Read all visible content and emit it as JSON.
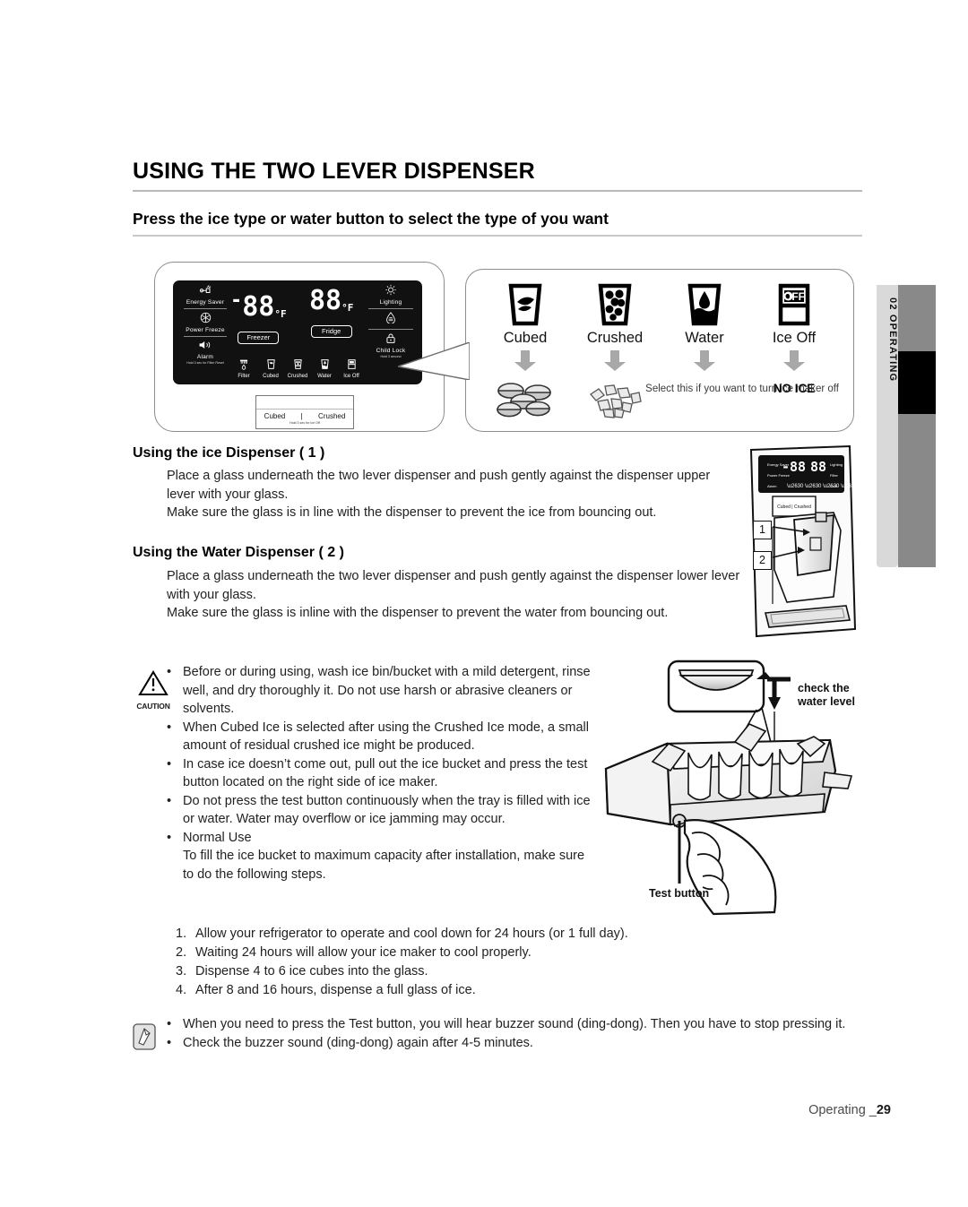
{
  "page": {
    "title": "USING THE TWO LEVER DISPENSER",
    "subtitle": "Press the ice type or water button to select the type of you want",
    "footer_label": "Operating _",
    "footer_page": "29"
  },
  "side_tab": {
    "label": "02  OPERATING"
  },
  "control_panel": {
    "left_items": [
      {
        "icon": "energy-saver-icon",
        "glyph": "⚡",
        "label": "Energy Saver",
        "sub": ""
      },
      {
        "icon": "power-freeze-icon",
        "glyph": "❄",
        "label": "Power Freeze",
        "sub": ""
      },
      {
        "icon": "alarm-icon",
        "glyph": "🔊",
        "label": "Alarm",
        "sub": "Hold 3 sec for Filter Reset"
      }
    ],
    "right_items": [
      {
        "icon": "lighting-icon",
        "glyph": "☀",
        "label": "Lighting",
        "sub": ""
      },
      {
        "icon": "water-drop-icon",
        "glyph": "💧",
        "label": "",
        "sub": ""
      },
      {
        "icon": "child-lock-icon",
        "glyph": "🔒",
        "label": "Child Lock",
        "sub": "Hold 3 second"
      }
    ],
    "freezer": {
      "minus": "-",
      "digits": "88",
      "unit": "°F",
      "button": "Freezer"
    },
    "fridge": {
      "minus": "",
      "digits": "88",
      "unit": "°F",
      "button": "Fridge"
    },
    "bottom_buttons": [
      {
        "icon": "filter-icon",
        "label": "Filter"
      },
      {
        "icon": "cubed-ice-icon",
        "label": "Cubed"
      },
      {
        "icon": "crushed-ice-icon",
        "label": "Crushed"
      },
      {
        "icon": "water-icon",
        "label": "Water"
      },
      {
        "icon": "ice-off-icon",
        "label": "Ice Off"
      }
    ],
    "lever_box": {
      "left_label": "Cubed",
      "separator": "|",
      "right_label": "Crushed",
      "note": "Hold 3 sec for Ice Off"
    }
  },
  "callout": {
    "options": [
      {
        "icon": "cubed-glass-icon",
        "label": "Cubed",
        "result_icon": "ice-cubes-icon"
      },
      {
        "icon": "crushed-glass-icon",
        "label": "Crushed",
        "result_icon": "crushed-ice-icon"
      },
      {
        "icon": "water-glass-icon",
        "label": "Water",
        "result_icon": ""
      },
      {
        "icon": "ice-off-icon",
        "label": "Ice Off",
        "result_icon": ""
      }
    ],
    "no_ice_label": "NO ICE",
    "no_ice_desc": "Select this if you want to turn ice maker off"
  },
  "sections": [
    {
      "heading": "Using the ice Dispenser ( 1 )",
      "body": "Place a glass underneath the two lever dispenser and push gently against the dispenser upper lever with your glass.\nMake sure the glass is in line with the dispenser to prevent the ice from bouncing out."
    },
    {
      "heading": "Using the Water Dispenser ( 2 )",
      "body": "Place a glass underneath the two lever dispenser and push gently against the dispenser lower lever with your glass.\nMake sure the glass is inline with the dispenser to prevent the water from bouncing out."
    }
  ],
  "caution": {
    "icon_label": "CAUTION",
    "bullets": [
      "Before or during using, wash ice bin/bucket with a mild detergent, rinse well, and dry thoroughly it. Do not use harsh or abrasive cleaners or solvents.",
      "When Cubed Ice is selected after using the Crushed Ice mode, a small amount of residual crushed ice might be produced.",
      "In case ice doesn’t come out, pull out the ice bucket and press the test button located on the right side of ice maker.",
      "Do not press the test button continuously when the tray is filled with ice or water. Water may overflow or ice jamming may occur.",
      "Normal Use"
    ],
    "normal_use_intro": "To fill the ice bucket to maximum capacity after installation, make sure to do the following steps.",
    "steps": [
      {
        "n": "1.",
        "text": "Allow your refrigerator to operate and cool down for 24 hours (or 1 full day)."
      },
      {
        "n": "2.",
        "text": "Waiting 24 hours will allow your ice maker to cool properly."
      },
      {
        "n": "3.",
        "text": "Dispense 4 to 6 ice cubes into the glass."
      },
      {
        "n": "4.",
        "text": "After 8 and 16 hours, dispense a full glass of ice."
      }
    ]
  },
  "note": {
    "icon": "note-hand-icon",
    "bullets": [
      "When you need to press the Test button, you will hear buzzer sound (ding-dong). Then you have to stop pressing it.",
      "Check the buzzer sound (ding-dong) again after 4-5 minutes."
    ]
  },
  "dispenser_illustration": {
    "callout_1": "1",
    "callout_2": "2"
  },
  "icemaker_illustration": {
    "water_level_label": "check the water level",
    "test_button_label": "Test button"
  }
}
